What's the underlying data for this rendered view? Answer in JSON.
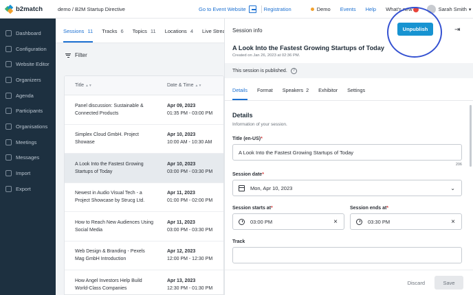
{
  "app": {
    "logo_text": "b2match",
    "breadcrumb": "demo / B2M Startup Directive"
  },
  "topnav": {
    "go_to_event": "Go to Event Website",
    "registration": "Registration",
    "demo": "Demo",
    "events": "Events",
    "help": "Help",
    "whats_new": "What's new",
    "user": "Sarah Smith"
  },
  "sidebar": {
    "items": [
      {
        "label": "Dashboard",
        "icon": "dashboard-icon"
      },
      {
        "label": "Configuration",
        "icon": "wrench-icon"
      },
      {
        "label": "Website Editor",
        "icon": "monitor-icon"
      },
      {
        "label": "Organizers",
        "icon": "users-icon"
      },
      {
        "label": "Agenda",
        "icon": "calendar-icon"
      },
      {
        "label": "Participants",
        "icon": "participants-icon"
      },
      {
        "label": "Organisations",
        "icon": "building-icon"
      },
      {
        "label": "Meetings",
        "icon": "meetings-icon"
      },
      {
        "label": "Messages",
        "icon": "messages-icon"
      },
      {
        "label": "Import",
        "icon": "import-icon"
      },
      {
        "label": "Export",
        "icon": "export-icon"
      }
    ]
  },
  "list": {
    "tabs": [
      {
        "label": "Sessions",
        "count": "11"
      },
      {
        "label": "Tracks",
        "count": "6"
      },
      {
        "label": "Topics",
        "count": "11"
      },
      {
        "label": "Locations",
        "count": "4"
      },
      {
        "label": "Live Streams",
        "count": ""
      }
    ],
    "filter_label": "Filter",
    "columns": {
      "title": "Title",
      "date": "Date & Time"
    },
    "rows": [
      {
        "title": "Panel discussion: Sustainable & Connected Products",
        "date": "Apr 09, 2023",
        "time": "01:35 PM - 03:00 PM"
      },
      {
        "title": "Simplex Cloud GmbH. Project Showase",
        "date": "Apr 10, 2023",
        "time": "10:00 AM - 10:30 AM"
      },
      {
        "title": "A Look Into the Fastest Growing Startups of Today",
        "date": "Apr 10, 2023",
        "time": "03:00 PM - 03:30 PM"
      },
      {
        "title": "Newest in Audio Visual Tech - a Project Showcase by Strucg Ltd.",
        "date": "Apr 11, 2023",
        "time": "01:00 PM - 02:00 PM"
      },
      {
        "title": "How to Reach New Audiences Using Social Media",
        "date": "Apr 11, 2023",
        "time": "03:00 PM - 03:30 PM"
      },
      {
        "title": "Web Design & Branding - Pexels Mag GmbH Introduction",
        "date": "Apr 12, 2023",
        "time": "12:00 PM - 12:30 PM"
      },
      {
        "title": "How Angel Investors Help Build World-Class Companies",
        "date": "Apr 13, 2023",
        "time": "12:30 PM - 01:30 PM"
      }
    ]
  },
  "panel": {
    "header": "Session info",
    "unpublish": "Unpublish",
    "title": "A Look Into the Fastest Growing Startups of Today",
    "created": "Created on Jan 26, 2023 at 02:36 PM.",
    "published_notice": "This session is published.",
    "tabs": [
      {
        "label": "Details",
        "count": ""
      },
      {
        "label": "Format",
        "count": ""
      },
      {
        "label": "Speakers",
        "count": "2"
      },
      {
        "label": "Exhibitor",
        "count": ""
      },
      {
        "label": "Settings",
        "count": ""
      }
    ],
    "details_heading": "Details",
    "details_sub": "Information of your session.",
    "title_label": "Title (en-US)",
    "title_value": "A Look Into the Fastest Growing Startups of Today",
    "title_counter": "206",
    "date_label": "Session date",
    "date_value": "Mon, Apr 10, 2023",
    "start_label": "Session starts at",
    "start_value": "03:00 PM",
    "end_label": "Session ends at",
    "end_value": "03:30 PM",
    "track_label": "Track",
    "discard": "Discard",
    "save": "Save"
  },
  "colors": {
    "accent": "#1a6fd1",
    "sidebar": "#1d3040",
    "button": "#1793d1",
    "highlight": "#3451d1"
  }
}
